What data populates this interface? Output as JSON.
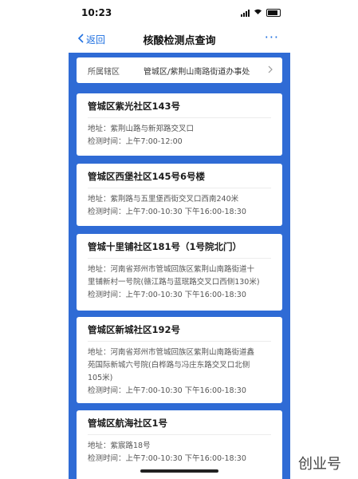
{
  "status": {
    "time": "10:23"
  },
  "nav": {
    "back_label": "返回",
    "title": "核酸检测点查询",
    "more_label": "···"
  },
  "district": {
    "label": "所属辖区",
    "value": "管城区/紫荆山南路街道办事处"
  },
  "labels": {
    "address": "地址：",
    "hours": "检测时间："
  },
  "sites": [
    {
      "name": "管城区紫光社区143号",
      "address_lines": [
        "紫荆山路与新郑路交叉口"
      ],
      "hours": "上午7:00-12:00"
    },
    {
      "name": "管城区西堡社区145号6号楼",
      "address_lines": [
        "紫荆路与五里堡西街交叉口西南240米"
      ],
      "hours": "上午7:00-10:30 下午16:00-18:30"
    },
    {
      "name": "管城十里铺社区181号（1号院北门）",
      "address_lines": [
        "河南省郑州市管城回族区紫荆山南路街道十",
        "里铺新村一号院(赣江路与蓝珉路交叉口西侧130米)"
      ],
      "hours": "上午7:00-10:30 下午16:00-18:30"
    },
    {
      "name": "管城区新城社区192号",
      "address_lines": [
        "河南省郑州市管城回族区紫荆山南路街道鑫",
        "苑国际新城六号院(白桦路与冯庄东路交叉口北侧",
        "105米)"
      ],
      "hours": "上午7:00-10:30 下午16:00-18:30"
    },
    {
      "name": "管城区航海社区1号",
      "address_lines": [
        "紫宸路18号"
      ],
      "hours": "上午7:00-10:30 下午16:00-18:30"
    }
  ],
  "watermark": "创业号"
}
